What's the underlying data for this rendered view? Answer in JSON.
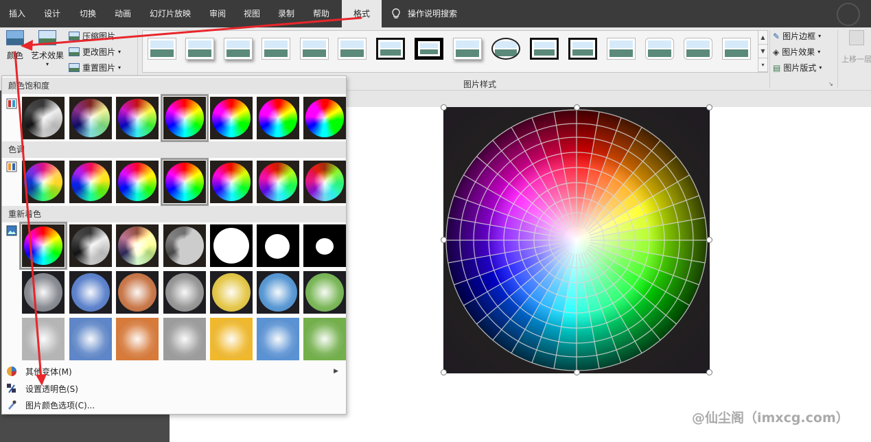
{
  "tabs": [
    {
      "label": "插入"
    },
    {
      "label": "设计"
    },
    {
      "label": "切换"
    },
    {
      "label": "动画"
    },
    {
      "label": "幻灯片放映"
    },
    {
      "label": "审阅"
    },
    {
      "label": "视图"
    },
    {
      "label": "录制"
    },
    {
      "label": "帮助"
    },
    {
      "label": "格式"
    }
  ],
  "tellme": {
    "label": "操作说明搜索"
  },
  "ribbon": {
    "color_button": "颜色",
    "art_effects": "艺术效果",
    "compress": "压缩图片",
    "change": "更改图片",
    "reset": "重置图片",
    "picture_styles_group": "图片样式",
    "picture_border": "图片边框",
    "picture_effects": "图片效果",
    "picture_layout": "图片版式",
    "bring_forward": "上移一层"
  },
  "dropdown": {
    "saturation_header": "颜色饱和度",
    "tone_header": "色调",
    "recolor_header": "重新着色",
    "more_variations": "其他变体(M)",
    "set_transparent": "设置透明色(S)",
    "color_options": "图片颜色选项(C)..."
  },
  "watermark": "@仙尘阁（imxcg.com）",
  "colors": {
    "annotation_arrow": "#e8262b",
    "tabbar": "#3b3b3b",
    "ribbon": "#e8e8e8"
  }
}
